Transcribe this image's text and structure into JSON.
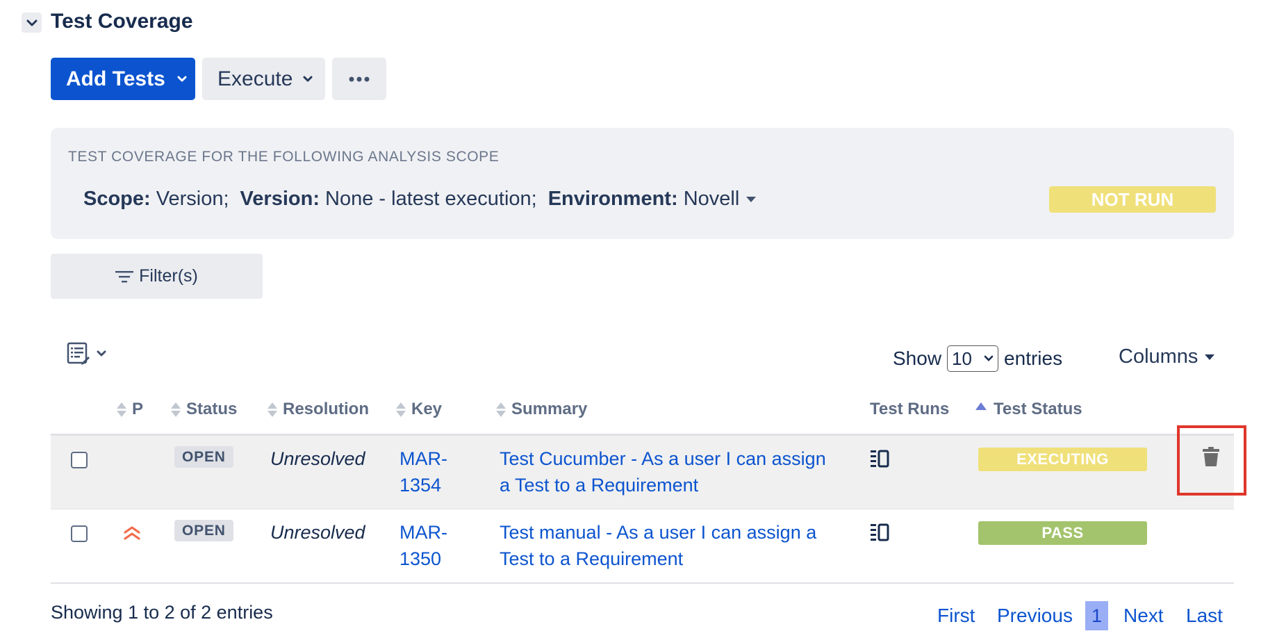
{
  "section": {
    "title": "Test Coverage"
  },
  "toolbar": {
    "add_tests": "Add Tests",
    "execute": "Execute"
  },
  "scope": {
    "heading": "TEST COVERAGE FOR THE FOLLOWING ANALYSIS SCOPE",
    "scope_label": "Scope:",
    "scope_value": "Version;",
    "version_label": "Version:",
    "version_value": "None - latest execution;",
    "environment_label": "Environment:",
    "environment_value": "Novell",
    "overall_status": "NOT RUN"
  },
  "filter": {
    "label": "Filter(s)"
  },
  "entries": {
    "show_label": "Show",
    "page_size": "10",
    "entries_label": "entries",
    "columns_label": "Columns"
  },
  "table": {
    "headers": {
      "p": "P",
      "status": "Status",
      "resolution": "Resolution",
      "key": "Key",
      "summary": "Summary",
      "test_runs": "Test Runs",
      "test_status": "Test Status"
    },
    "rows": [
      {
        "status": "OPEN",
        "resolution": "Unresolved",
        "key_line1": "MAR-",
        "key_line2": "1354",
        "summary_line1": "Test Cucumber - As a user I can assign",
        "summary_line2": "a Test to a Requirement",
        "test_status": "EXECUTING",
        "test_status_color": "#f0e07a"
      },
      {
        "priority_icon": "double-chevron-up-icon",
        "status": "OPEN",
        "resolution": "Unresolved",
        "key_line1": "MAR-",
        "key_line2": "1350",
        "summary_line1": "Test manual - As a user I can assign a",
        "summary_line2": "Test to a Requirement",
        "test_status": "PASS",
        "test_status_color": "#a3c46c"
      }
    ]
  },
  "footer": {
    "showing": "Showing 1 to 2 of 2 entries"
  },
  "pagination": {
    "first": "First",
    "previous": "Previous",
    "current": "1",
    "next": "Next",
    "last": "Last"
  },
  "colors": {
    "primary": "#0c54cf",
    "highlight": "#e0362a",
    "not_run": "#f0e07a",
    "pass": "#a3c46c",
    "priority": "#f26b4b"
  }
}
